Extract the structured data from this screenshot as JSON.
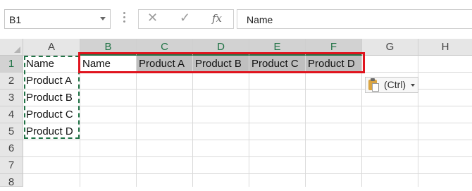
{
  "formula_bar": {
    "name_box": "B1",
    "cancel_symbol": "✕",
    "enter_symbol": "✓",
    "fx_label": "fx",
    "formula_value": "Name"
  },
  "columns": [
    "A",
    "B",
    "C",
    "D",
    "E",
    "F",
    "G",
    "H"
  ],
  "rows": [
    "1",
    "2",
    "3",
    "4",
    "5",
    "6",
    "7",
    "8"
  ],
  "cells": {
    "A1": "Name",
    "A2": "Product A",
    "A3": "Product B",
    "A4": "Product C",
    "A5": "Product D",
    "B1": "Name",
    "C1": "Product A",
    "D1": "Product B",
    "E1": "Product C",
    "F1": "Product D"
  },
  "paste_options": {
    "label": "(Ctrl)"
  },
  "colors": {
    "selection_accent": "#217346",
    "highlight_box": "#e0141e",
    "selected_fill": "#bfbfbf"
  }
}
